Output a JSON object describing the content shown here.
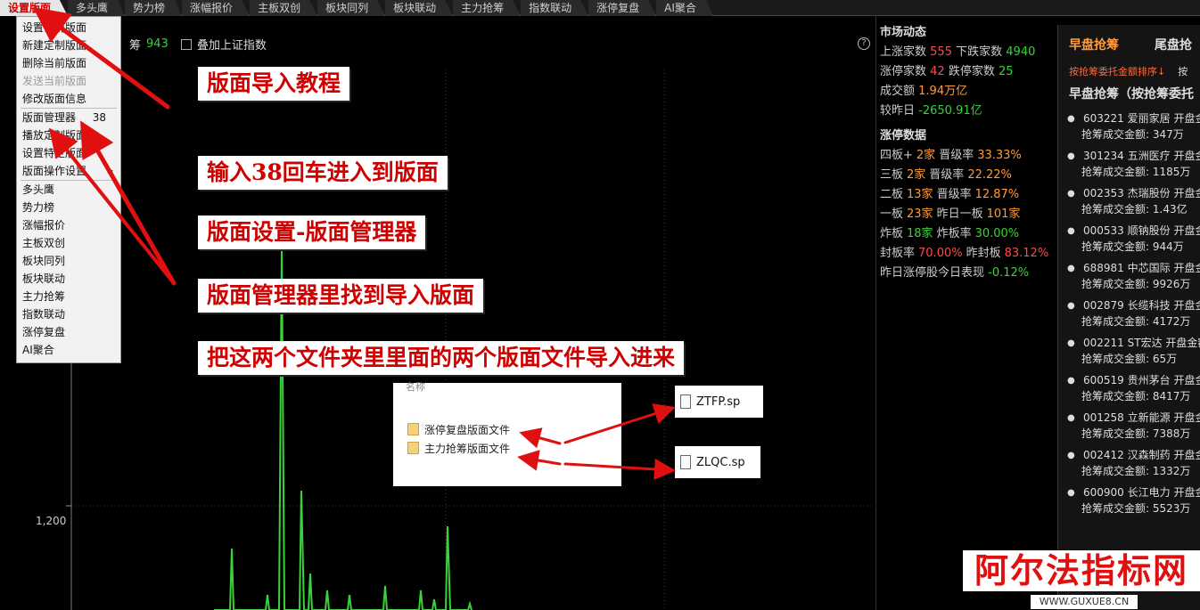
{
  "tabs": [
    "设置版面",
    "多头鹰",
    "势力榜",
    "涨幅报价",
    "主板双创",
    "板块同列",
    "板块联动",
    "主力抢筹",
    "指数联动",
    "涨停复盘",
    "AI聚合"
  ],
  "menu": {
    "items": [
      {
        "label": "设置当前版面",
        "disabled": false
      },
      {
        "label": "新建定制版面",
        "disabled": false
      },
      {
        "label": "删除当前版面",
        "disabled": false
      },
      {
        "label": "发送当前版面",
        "disabled": true
      },
      {
        "label": "修改版面信息",
        "disabled": false
      },
      {
        "sep": true
      },
      {
        "label": "版面管理器",
        "shortcut": "38"
      },
      {
        "label": "播放定制版面"
      },
      {
        "label": "设置特定版面"
      },
      {
        "label": "版面操作设置",
        "submenu": true
      },
      {
        "sep": true
      },
      {
        "label": "多头鹰"
      },
      {
        "label": "势力榜"
      },
      {
        "label": "涨幅报价"
      },
      {
        "label": "主板双创"
      },
      {
        "label": "板块同列"
      },
      {
        "label": "板块联动"
      },
      {
        "label": "主力抢筹"
      },
      {
        "label": "指数联动"
      },
      {
        "label": "涨停复盘"
      },
      {
        "label": "AI聚合"
      }
    ]
  },
  "chart": {
    "header_label": "筹",
    "header_value": "943",
    "overlay_label": "叠加上证指数",
    "help": "?",
    "y_tick": "1,200",
    "line_color": "#3ad23a"
  },
  "annotations": {
    "a1": "版面导入教程",
    "a2": "输入38回车进入到版面",
    "a3": "版面设置-版面管理器",
    "a4": "版面管理器里找到导入版面",
    "a5": "把这两个文件夹里里面的两个版面文件导入进来"
  },
  "explorer": {
    "header": "名称",
    "folders": [
      "涨停复盘版面文件",
      "主力抢筹版面文件"
    ],
    "files": [
      "ZTFP.sp",
      "ZLQC.sp"
    ]
  },
  "market": {
    "title": "市场动态",
    "up_label": "上涨家数",
    "up_value": "555",
    "down_label": "下跌家数",
    "down_value": "4940",
    "limitup_label": "涨停家数",
    "limitup_value": "42",
    "limitdown_label": "跌停家数",
    "limitdown_value": "25",
    "turnover_label": "成交额",
    "turnover_value": "1.94万亿",
    "vs_label": "较昨日",
    "vs_value": "-2650.91亿",
    "limit_title": "涨停数据",
    "rows": [
      {
        "a": "四板+",
        "b": "2家",
        "c": "晋级率",
        "d": "33.33%"
      },
      {
        "a": "三板",
        "b": "2家",
        "c": "晋级率",
        "d": "22.22%"
      },
      {
        "a": "二板",
        "b": "13家",
        "c": "晋级率",
        "d": "12.87%"
      },
      {
        "a": "一板",
        "b": "23家",
        "c": "昨日一板",
        "d": "101家"
      },
      {
        "a": "炸板",
        "b": "18家",
        "c": "炸板率",
        "d": "30.00%"
      },
      {
        "a": "封板率",
        "b": "70.00%",
        "c": "昨封板",
        "d": "83.12%"
      }
    ],
    "yesterday_label": "昨日涨停股今日表现",
    "yesterday_value": "-0.12%"
  },
  "right_panel": {
    "tab1": "早盘抢筹",
    "tab2": "尾盘抢",
    "sub1": "按抢筹委托金额排序↓",
    "sub2": "按",
    "title": "早盘抢筹（按抢筹委托",
    "stocks": [
      {
        "code": "603221",
        "name": "爱丽家居",
        "tail": "开盘金",
        "amount_label": "抢筹成交金额:",
        "amount": "347万"
      },
      {
        "code": "301234",
        "name": "五洲医疗",
        "tail": "开盘金",
        "amount_label": "抢筹成交金额:",
        "amount": "1185万"
      },
      {
        "code": "002353",
        "name": "杰瑞股份",
        "tail": "开盘金",
        "amount_label": "抢筹成交金额:",
        "amount": "1.43亿"
      },
      {
        "code": "000533",
        "name": "顺钠股份",
        "tail": "开盘金",
        "amount_label": "抢筹成交金额:",
        "amount": "944万"
      },
      {
        "code": "688981",
        "name": "中芯国际",
        "tail": "开盘金",
        "amount_label": "抢筹成交金额:",
        "amount": "9926万"
      },
      {
        "code": "002879",
        "name": "长缆科技",
        "tail": "开盘金",
        "amount_label": "抢筹成交金额:",
        "amount": "4172万"
      },
      {
        "code": "002211",
        "name": "ST宏达",
        "tail": "开盘金額",
        "amount_label": "抢筹成交金额:",
        "amount": "65万"
      },
      {
        "code": "600519",
        "name": "贵州茅台",
        "tail": "开盘金",
        "amount_label": "抢筹成交金额:",
        "amount": "8417万"
      },
      {
        "code": "001258",
        "name": "立新能源",
        "tail": "开盘金",
        "amount_label": "抢筹成交金额:",
        "amount": "7388万"
      },
      {
        "code": "002412",
        "name": "汉森制药",
        "tail": "开盘金",
        "amount_label": "抢筹成交金额:",
        "amount": "1332万"
      },
      {
        "code": "600900",
        "name": "长江电力",
        "tail": "开盘金",
        "amount_label": "抢筹成交金额:",
        "amount": "5523万"
      }
    ]
  },
  "watermark": {
    "title": "阿尔法指标网",
    "url": "WWW.GUXUE8.CN"
  }
}
